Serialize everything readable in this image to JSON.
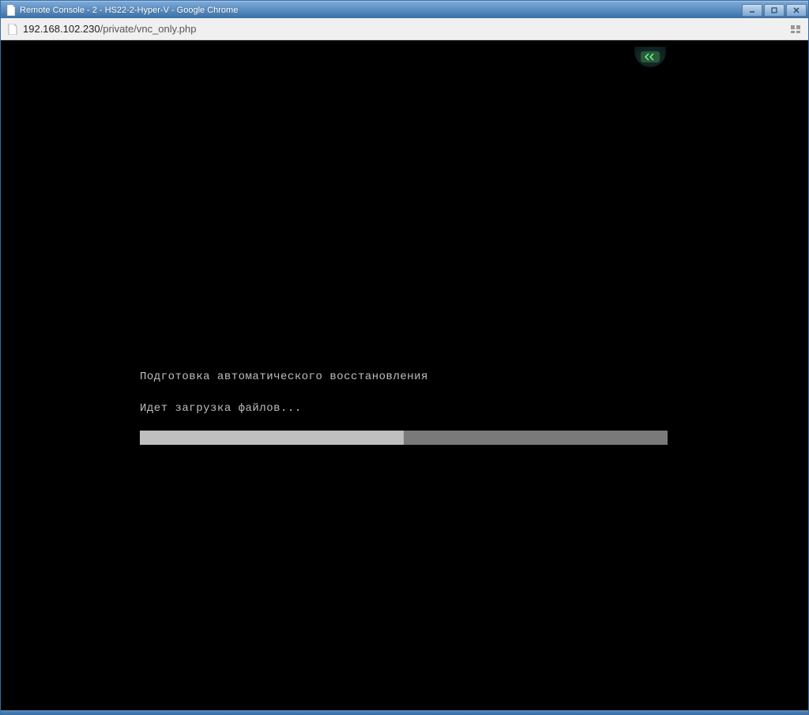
{
  "window": {
    "title": "Remote Console - 2 - HS22-2-Hyper-V - Google Chrome"
  },
  "addressbar": {
    "host": "192.168.102.230",
    "path": "/private/vnc_only.php"
  },
  "boot": {
    "line1": "Подготовка автоматического восстановления",
    "line2": "Идет загрузка файлов...",
    "progress_percent": 50
  }
}
